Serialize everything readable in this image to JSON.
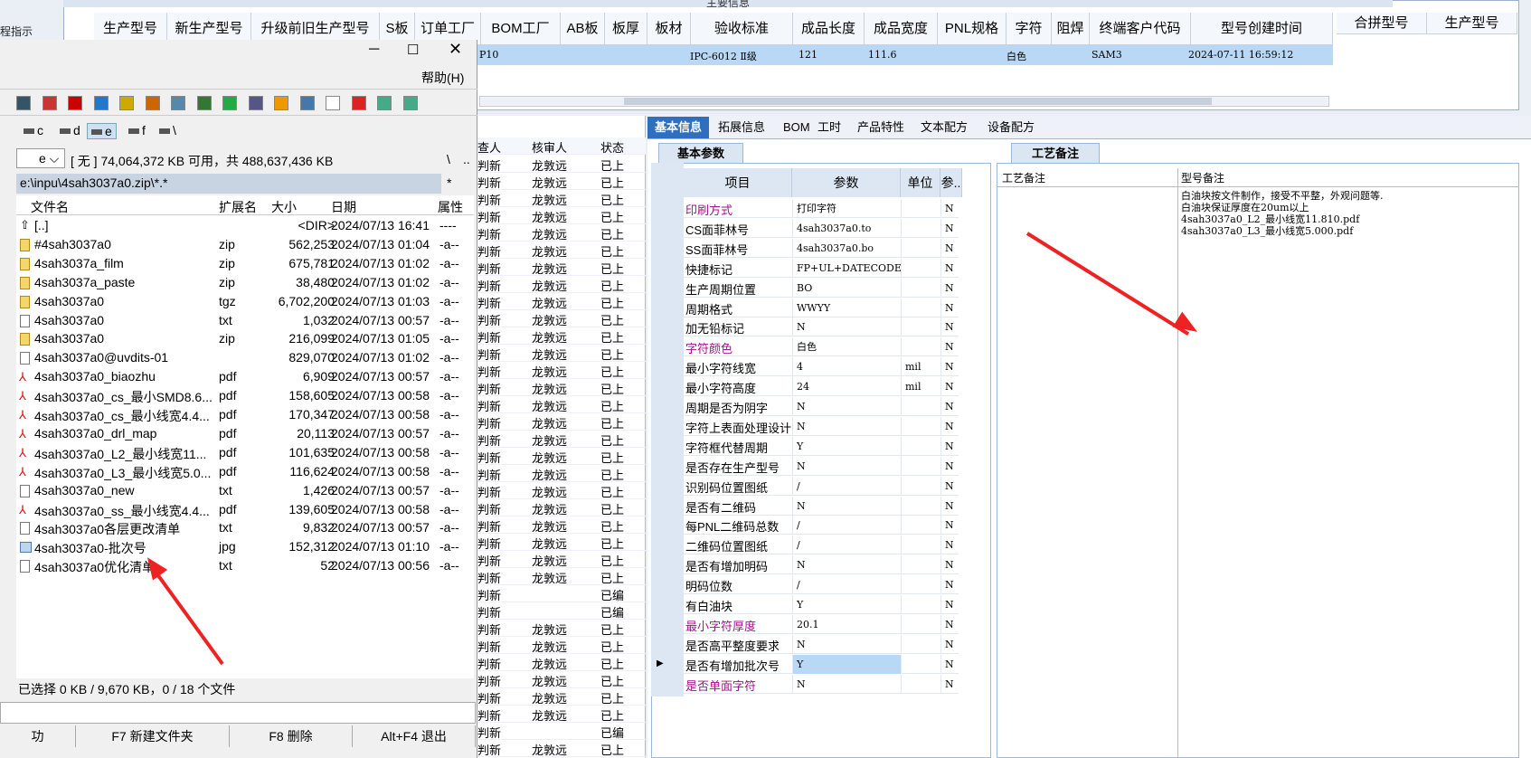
{
  "top": {
    "title": "主要信息",
    "left_label": "程指示",
    "headers": [
      "生产型号",
      "新生产型号",
      "升级前旧生产型号",
      "S板",
      "订单工厂",
      "BOM工厂",
      "AB板",
      "板厚",
      "板材",
      "验收标准",
      "成品长度",
      "成品宽度",
      "PNL规格",
      "字符",
      "阻焊",
      "终端客户代码",
      "型号创建时间",
      "合拼型号",
      "生产型号"
    ],
    "row": {
      "factory": "P10",
      "standard": "IPC-6012 Ⅱ级",
      "length": "121",
      "width": "111.6",
      "char": "白色",
      "customer": "SAM3",
      "created": "2024-07-11 16:59:12"
    }
  },
  "fm": {
    "menu_help": "帮助(H)",
    "drives": [
      "c",
      "d",
      "e",
      "f",
      "\\"
    ],
    "drive_select": "e",
    "free_space": "[ 无 ]  74,064,372 KB 可用，共 488,637,436 KB",
    "path": "e:\\inpu\\4sah3037a0.zip\\*.*",
    "path_mask": "*",
    "path_btn1": "\\",
    "path_btn2": "..",
    "columns": {
      "name": "文件名",
      "ext": "扩展名",
      "size": "大小",
      "date": "日期",
      "attr": "属性"
    },
    "files": [
      {
        "name": "[..]",
        "ext": "",
        "size": "<DIR>",
        "date": "2024/07/13 16:41",
        "attr": "----",
        "icon": "up"
      },
      {
        "name": "#4sah3037a0",
        "ext": "zip",
        "size": "562,253",
        "date": "2024/07/13 01:04",
        "attr": "-a--",
        "icon": "zip"
      },
      {
        "name": "4sah3037a_film",
        "ext": "zip",
        "size": "675,781",
        "date": "2024/07/13 01:02",
        "attr": "-a--",
        "icon": "zip"
      },
      {
        "name": "4sah3037a_paste",
        "ext": "zip",
        "size": "38,480",
        "date": "2024/07/13 01:02",
        "attr": "-a--",
        "icon": "zip"
      },
      {
        "name": "4sah3037a0",
        "ext": "tgz",
        "size": "6,702,200",
        "date": "2024/07/13 01:03",
        "attr": "-a--",
        "icon": "zip"
      },
      {
        "name": "4sah3037a0",
        "ext": "txt",
        "size": "1,032",
        "date": "2024/07/13 00:57",
        "attr": "-a--",
        "icon": "doc"
      },
      {
        "name": "4sah3037a0",
        "ext": "zip",
        "size": "216,099",
        "date": "2024/07/13 01:05",
        "attr": "-a--",
        "icon": "zip"
      },
      {
        "name": "4sah3037a0@uvdits-01",
        "ext": "",
        "size": "829,070",
        "date": "2024/07/13 01:02",
        "attr": "-a--",
        "icon": "doc"
      },
      {
        "name": "4sah3037a0_biaozhu",
        "ext": "pdf",
        "size": "6,909",
        "date": "2024/07/13 00:57",
        "attr": "-a--",
        "icon": "pdf"
      },
      {
        "name": "4sah3037a0_cs_最小SMD8.6...",
        "ext": "pdf",
        "size": "158,605",
        "date": "2024/07/13 00:58",
        "attr": "-a--",
        "icon": "pdf"
      },
      {
        "name": "4sah3037a0_cs_最小线宽4.4...",
        "ext": "pdf",
        "size": "170,347",
        "date": "2024/07/13 00:58",
        "attr": "-a--",
        "icon": "pdf"
      },
      {
        "name": "4sah3037a0_drl_map",
        "ext": "pdf",
        "size": "20,113",
        "date": "2024/07/13 00:57",
        "attr": "-a--",
        "icon": "pdf"
      },
      {
        "name": "4sah3037a0_L2_最小线宽11...",
        "ext": "pdf",
        "size": "101,635",
        "date": "2024/07/13 00:58",
        "attr": "-a--",
        "icon": "pdf"
      },
      {
        "name": "4sah3037a0_L3_最小线宽5.0...",
        "ext": "pdf",
        "size": "116,624",
        "date": "2024/07/13 00:58",
        "attr": "-a--",
        "icon": "pdf"
      },
      {
        "name": "4sah3037a0_new",
        "ext": "txt",
        "size": "1,426",
        "date": "2024/07/13 00:57",
        "attr": "-a--",
        "icon": "doc"
      },
      {
        "name": "4sah3037a0_ss_最小线宽4.4...",
        "ext": "pdf",
        "size": "139,605",
        "date": "2024/07/13 00:58",
        "attr": "-a--",
        "icon": "pdf"
      },
      {
        "name": "4sah3037a0各层更改清单",
        "ext": "txt",
        "size": "9,832",
        "date": "2024/07/13 00:57",
        "attr": "-a--",
        "icon": "doc"
      },
      {
        "name": "4sah3037a0-批次号",
        "ext": "jpg",
        "size": "152,312",
        "date": "2024/07/13 01:10",
        "attr": "-a--",
        "icon": "img"
      },
      {
        "name": "4sah3037a0优化清单",
        "ext": "txt",
        "size": "52",
        "date": "2024/07/13 00:56",
        "attr": "-a--",
        "icon": "doc"
      }
    ],
    "status": "已选择 0 KB / 9,670 KB，0 / 18 个文件",
    "fkeys": [
      "功",
      "F7 新建文件夹",
      "F8 删除",
      "Alt+F4 退出"
    ]
  },
  "mid": {
    "headers": [
      "查人",
      "核审人",
      "状态"
    ],
    "rows": [
      [
        "判新",
        "龙敦远",
        "已上"
      ],
      [
        "判新",
        "龙敦远",
        "已上"
      ],
      [
        "判新",
        "龙敦远",
        "已上"
      ],
      [
        "判新",
        "龙敦远",
        "已上"
      ],
      [
        "判新",
        "龙敦远",
        "已上"
      ],
      [
        "判新",
        "龙敦远",
        "已上"
      ],
      [
        "判新",
        "龙敦远",
        "已上"
      ],
      [
        "判新",
        "龙敦远",
        "已上"
      ],
      [
        "判新",
        "龙敦远",
        "已上"
      ],
      [
        "判新",
        "龙敦远",
        "已上"
      ],
      [
        "判新",
        "龙敦远",
        "已上"
      ],
      [
        "判新",
        "龙敦远",
        "已上"
      ],
      [
        "判新",
        "龙敦远",
        "已上"
      ],
      [
        "判新",
        "龙敦远",
        "已上"
      ],
      [
        "判新",
        "龙敦远",
        "已上"
      ],
      [
        "判新",
        "龙敦远",
        "已上"
      ],
      [
        "判新",
        "龙敦远",
        "已上"
      ],
      [
        "判新",
        "龙敦远",
        "已上"
      ],
      [
        "判新",
        "龙敦远",
        "已上"
      ],
      [
        "判新",
        "龙敦远",
        "已上"
      ],
      [
        "判新",
        "龙敦远",
        "已上"
      ],
      [
        "判新",
        "龙敦远",
        "已上"
      ],
      [
        "判新",
        "龙敦远",
        "已上"
      ],
      [
        "判新",
        "龙敦远",
        "已上"
      ],
      [
        "判新",
        "龙敦远",
        "已上"
      ],
      [
        "判新",
        "",
        "已编"
      ],
      [
        "判新",
        "",
        "已编"
      ],
      [
        "判新",
        "龙敦远",
        "已上"
      ],
      [
        "判新",
        "龙敦远",
        "已上"
      ],
      [
        "判新",
        "龙敦远",
        "已上"
      ],
      [
        "判新",
        "龙敦远",
        "已上"
      ],
      [
        "判新",
        "龙敦远",
        "已上"
      ],
      [
        "判新",
        "龙敦远",
        "已上"
      ],
      [
        "判新",
        "",
        "已编"
      ],
      [
        "判新",
        "龙敦远",
        "已上"
      ]
    ]
  },
  "right": {
    "tabs": [
      "基本信息",
      "拓展信息",
      "BOM",
      "工时",
      "产品特性",
      "文本配方",
      "设备配方"
    ],
    "subtab": "基本参数",
    "craft_tab": "工艺备注",
    "grid_headers": [
      "项目",
      "参数",
      "单位",
      "参.."
    ],
    "grid": [
      {
        "item": "印刷方式",
        "val": "打印字符",
        "unit": "",
        "p": "N",
        "purple": true
      },
      {
        "item": "CS面菲林号",
        "val": "4sah3037a0.to",
        "unit": "",
        "p": "N",
        "purple": false
      },
      {
        "item": "SS面菲林号",
        "val": "4sah3037a0.bo",
        "unit": "",
        "p": "N",
        "purple": false
      },
      {
        "item": "快捷标记",
        "val": "FP+UL+DATECODE",
        "unit": "",
        "p": "N",
        "purple": false
      },
      {
        "item": "生产周期位置",
        "val": "BO",
        "unit": "",
        "p": "N",
        "purple": false
      },
      {
        "item": "周期格式",
        "val": "WWYY",
        "unit": "",
        "p": "N",
        "purple": false
      },
      {
        "item": "加无铅标记",
        "val": "N",
        "unit": "",
        "p": "N",
        "purple": false
      },
      {
        "item": "字符颜色",
        "val": "白色",
        "unit": "",
        "p": "N",
        "purple": true
      },
      {
        "item": "最小字符线宽",
        "val": "4",
        "unit": "mil",
        "p": "N",
        "purple": false
      },
      {
        "item": "最小字符高度",
        "val": "24",
        "unit": "mil",
        "p": "N",
        "purple": false
      },
      {
        "item": "周期是否为阴字",
        "val": "N",
        "unit": "",
        "p": "N",
        "purple": false
      },
      {
        "item": "字符上表面处理设计",
        "val": "N",
        "unit": "",
        "p": "N",
        "purple": false
      },
      {
        "item": "字符框代替周期",
        "val": "Y",
        "unit": "",
        "p": "N",
        "purple": false
      },
      {
        "item": "是否存在生产型号",
        "val": "N",
        "unit": "",
        "p": "N",
        "purple": false
      },
      {
        "item": "识别码位置图纸",
        "val": "/",
        "unit": "",
        "p": "N",
        "purple": false
      },
      {
        "item": "是否有二维码",
        "val": "N",
        "unit": "",
        "p": "N",
        "purple": false
      },
      {
        "item": "每PNL二维码总数",
        "val": "/",
        "unit": "",
        "p": "N",
        "purple": false
      },
      {
        "item": "二维码位置图纸",
        "val": "/",
        "unit": "",
        "p": "N",
        "purple": false
      },
      {
        "item": "是否有增加明码",
        "val": "N",
        "unit": "",
        "p": "N",
        "purple": false
      },
      {
        "item": "明码位数",
        "val": "/",
        "unit": "",
        "p": "N",
        "purple": false
      },
      {
        "item": "有白油块",
        "val": "Y",
        "unit": "",
        "p": "N",
        "purple": false
      },
      {
        "item": "最小字符厚度",
        "val": "20.1",
        "unit": "",
        "p": "N",
        "purple": true
      },
      {
        "item": "是否高平整度要求",
        "val": "N",
        "unit": "",
        "p": "N",
        "purple": false
      },
      {
        "item": "是否有增加批次号",
        "val": "Y",
        "unit": "",
        "p": "N",
        "purple": false
      },
      {
        "item": "是否单面字符",
        "val": "N",
        "unit": "",
        "p": "N",
        "purple": true
      }
    ],
    "notes_headers": [
      "工艺备注",
      "型号备注"
    ],
    "notes": [
      "白油块按文件制作，接受不平整，外观问题等.",
      "白油块保证厚度在20um以上",
      "4sah3037a0_L2_最小线宽11.810.pdf",
      "4sah3037a0_L3_最小线宽5.000.pdf"
    ]
  },
  "colors": {
    "accent": "#b9d8f5",
    "arrow": "#ee2222",
    "purple": "#a0138a"
  }
}
